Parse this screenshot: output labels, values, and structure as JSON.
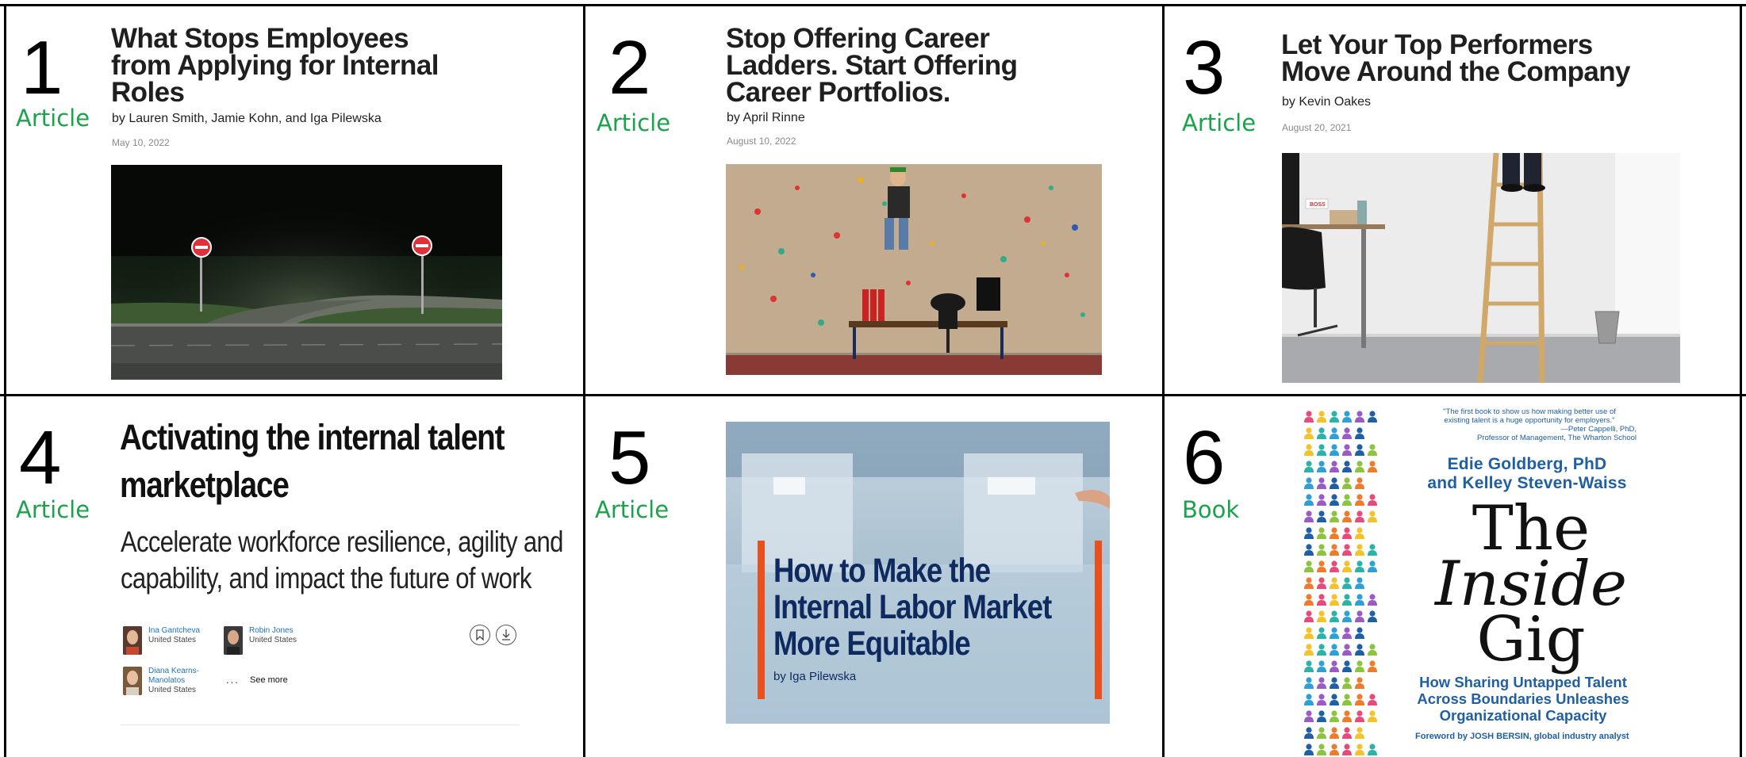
{
  "cards": [
    {
      "number": "1",
      "type": "Article",
      "title_lines": [
        "What Stops Employees",
        "from Applying for Internal",
        "Roles"
      ],
      "byline": "by Lauren Smith, Jamie Kohn, and Iga Pilewska",
      "date": "May 10, 2022"
    },
    {
      "number": "2",
      "type": "Article",
      "title_lines": [
        "Stop Offering Career",
        "Ladders. Start Offering",
        "Career Portfolios."
      ],
      "byline": "by April Rinne",
      "date": "August 10, 2022"
    },
    {
      "number": "3",
      "type": "Article",
      "title_lines": [
        "Let Your Top Performers",
        "Move Around the Company"
      ],
      "byline": "by Kevin Oakes",
      "date": "August 20, 2021",
      "image_label": "BOSS"
    },
    {
      "number": "4",
      "type": "Article",
      "title_lines": [
        "Activating the internal talent",
        "marketplace"
      ],
      "subtitle_lines": [
        "Accelerate workforce resilience, agility and",
        "capability, and impact the future of work"
      ],
      "authors": [
        {
          "name": "Ina Gantcheva",
          "location": "United States"
        },
        {
          "name": "Robin Jones",
          "location": "United States"
        },
        {
          "name_lines": [
            "Diana Kearns-",
            "Manolatos"
          ],
          "location": "United States"
        }
      ],
      "more_dots": "...",
      "see_more": "See more"
    },
    {
      "number": "5",
      "type": "Article",
      "image_title_lines": [
        "How to Make the",
        "Internal Labor Market",
        "More Equitable"
      ],
      "image_byline": "by Iga Pilewska"
    },
    {
      "number": "6",
      "type": "Book",
      "quote_lines": [
        "\"The first book to show us how making better use of",
        "existing talent is a huge opportunity for employers.\"",
        "—Peter Cappelli, PhD,",
        "Professor of Management, The Wharton School"
      ],
      "authors_lines": [
        "Edie Goldberg, PhD",
        "and Kelley Steven-Waiss"
      ],
      "title_lines": [
        "The",
        "Inside",
        "Gig"
      ],
      "subtitle_lines": [
        "How Sharing Untapped Talent",
        "Across Boundaries Unleashes",
        "Organizational Capacity"
      ],
      "foreword": "Foreword by JOSH BERSIN, global industry analyst"
    }
  ],
  "colors": {
    "type_label": "#1aa34a",
    "grid_lines": "#000000",
    "book_blue": "#1f5fa6",
    "c5_navy": "#0e2a5e",
    "c5_accent": "#e8501c"
  }
}
